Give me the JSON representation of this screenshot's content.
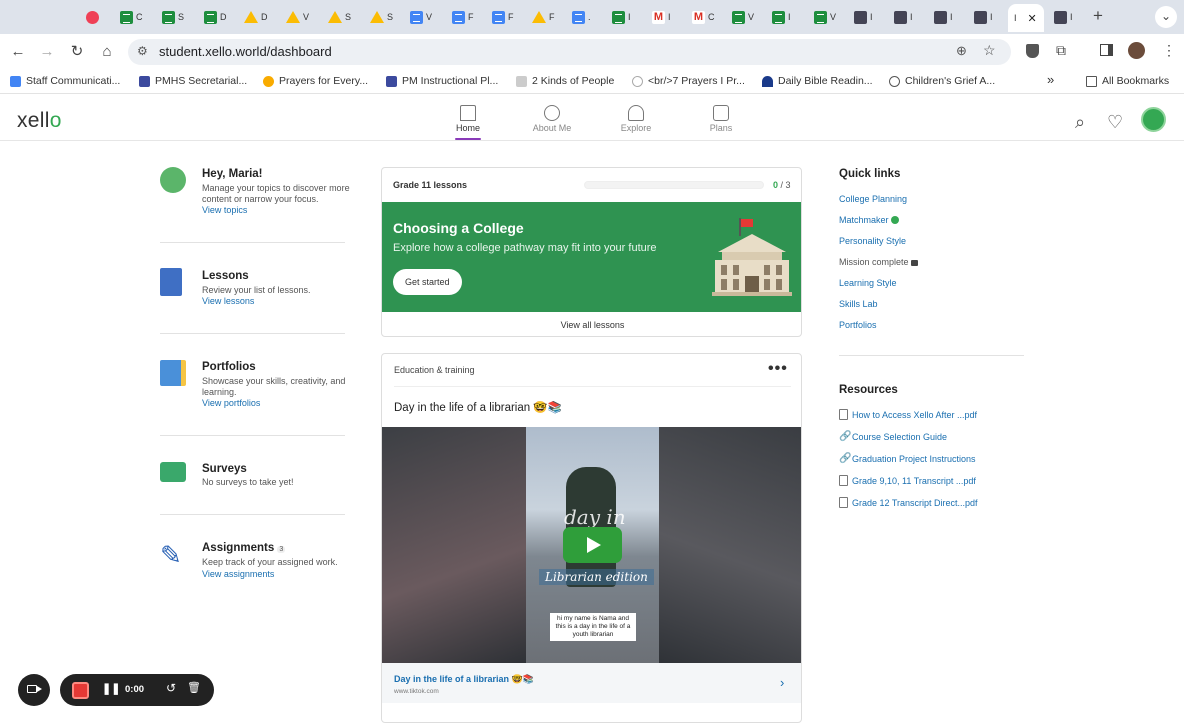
{
  "browser": {
    "tabs": [
      {
        "icon": "pocket-icon",
        "label": ""
      },
      {
        "icon": "sheets-icon",
        "label": "C"
      },
      {
        "icon": "sheets-icon",
        "label": "S"
      },
      {
        "icon": "sheets-icon",
        "label": "D"
      },
      {
        "icon": "drive-icon",
        "label": "D"
      },
      {
        "icon": "drive-icon",
        "label": "V"
      },
      {
        "icon": "drive-icon",
        "label": "S"
      },
      {
        "icon": "drive-icon",
        "label": "S"
      },
      {
        "icon": "docs-icon",
        "label": "V"
      },
      {
        "icon": "docs-icon",
        "label": "F"
      },
      {
        "icon": "docs-icon",
        "label": "F"
      },
      {
        "icon": "drive-icon",
        "label": "F"
      },
      {
        "icon": "docs-icon",
        "label": "."
      },
      {
        "icon": "sheets-icon",
        "label": "I"
      },
      {
        "icon": "gmail-icon",
        "label": "I"
      },
      {
        "icon": "gmail-icon",
        "label": "C"
      },
      {
        "icon": "sheets-icon",
        "label": "V"
      },
      {
        "icon": "sheets-icon",
        "label": "I"
      },
      {
        "icon": "sheets-icon",
        "label": "V"
      },
      {
        "icon": "app-icon",
        "label": "I"
      },
      {
        "icon": "app-icon",
        "label": "I"
      },
      {
        "icon": "app-icon",
        "label": "I"
      },
      {
        "icon": "app-icon",
        "label": "I"
      },
      {
        "icon": "xello-icon",
        "label": "I",
        "active": true
      },
      {
        "icon": "xello-icon",
        "label": "I"
      }
    ],
    "close_tab_glyph": "✕",
    "new_tab_glyph": "+",
    "tab_menu_glyph": "⌄",
    "url": "student.xello.world/dashboard",
    "bookmarks": [
      {
        "label": "Staff Communicati...",
        "color": "#4285f4"
      },
      {
        "label": "PMHS Secretarial...",
        "color": "#3c4a9e"
      },
      {
        "label": "Prayers for Every...",
        "color": "#f9ab00"
      },
      {
        "label": "PM Instructional Pl...",
        "color": "#3c4a9e"
      },
      {
        "label": "2 Kinds of People",
        "color": "#999999"
      },
      {
        "label": "<br/>7 Prayers I Pr...",
        "color": "#888888"
      },
      {
        "label": "Daily Bible Readin...",
        "color": "#1a3a8a"
      },
      {
        "label": "Children's Grief A...",
        "color": "#555555"
      }
    ],
    "bookmarks_overflow": "»",
    "all_bookmarks": "All Bookmarks"
  },
  "app": {
    "logo_text": "xell",
    "logo_o": "o",
    "nav": [
      {
        "label": "Home",
        "active": true
      },
      {
        "label": "About Me"
      },
      {
        "label": "Explore"
      },
      {
        "label": "Plans"
      }
    ]
  },
  "left": {
    "greeting_title": "Hey, Maria!",
    "greeting_desc": "Manage your topics to discover more content or narrow your focus.",
    "greeting_link": "View topics",
    "lessons_title": "Lessons",
    "lessons_desc": "Review your list of lessons.",
    "lessons_link": "View lessons",
    "portfolios_title": "Portfolios",
    "portfolios_desc": "Showcase your skills, creativity, and learning.",
    "portfolios_link": "View portfolios",
    "surveys_title": "Surveys",
    "surveys_desc": "No surveys to take yet!",
    "assignments_title": "Assignments",
    "assignments_count": "3",
    "assignments_desc": "Keep track of your assigned work.",
    "assignments_link": "View assignments"
  },
  "lessons_card": {
    "grade_label": "Grade 11 lessons",
    "progress_done": "0",
    "progress_total": "/ 3",
    "progress_fraction": 0,
    "banner_title": "Choosing a College",
    "banner_sub": "Explore how a college pathway may fit into your future",
    "cta": "Get started",
    "view_all": "View all lessons"
  },
  "post_card": {
    "category": "Education & training",
    "more": "•••",
    "title": "Day in the life of a librarian 🤓📚",
    "video_overlay_1": "day in",
    "video_overlay_2": "Librarian edition",
    "video_caption": "hi my name is Nama and this is a day in the life of a youth librarian",
    "link_title": "Day in the life of a librarian 🤓📚",
    "link_source": "www.tiktok.com",
    "link_chevron": "›"
  },
  "quick_links": {
    "title": "Quick links",
    "items": [
      {
        "label": "College Planning"
      },
      {
        "label": "Matchmaker"
      },
      {
        "label": "Personality Style"
      },
      {
        "label": "Mission complete"
      },
      {
        "label": "Learning Style"
      },
      {
        "label": "Skills Lab"
      },
      {
        "label": "Portfolios"
      }
    ]
  },
  "resources": {
    "title": "Resources",
    "items": [
      {
        "label": "How to Access Xello After ...pdf",
        "icon": "pdf-icon"
      },
      {
        "label": "Course Selection Guide",
        "icon": "link-icon"
      },
      {
        "label": "Graduation Project Instructions",
        "icon": "link-icon"
      },
      {
        "label": "Grade 9,10, 11 Transcript ...pdf",
        "icon": "pdf-icon"
      },
      {
        "label": "Grade 12 Transcript Direct...pdf",
        "icon": "pdf-icon"
      }
    ]
  },
  "recorder": {
    "time": "0:00"
  }
}
